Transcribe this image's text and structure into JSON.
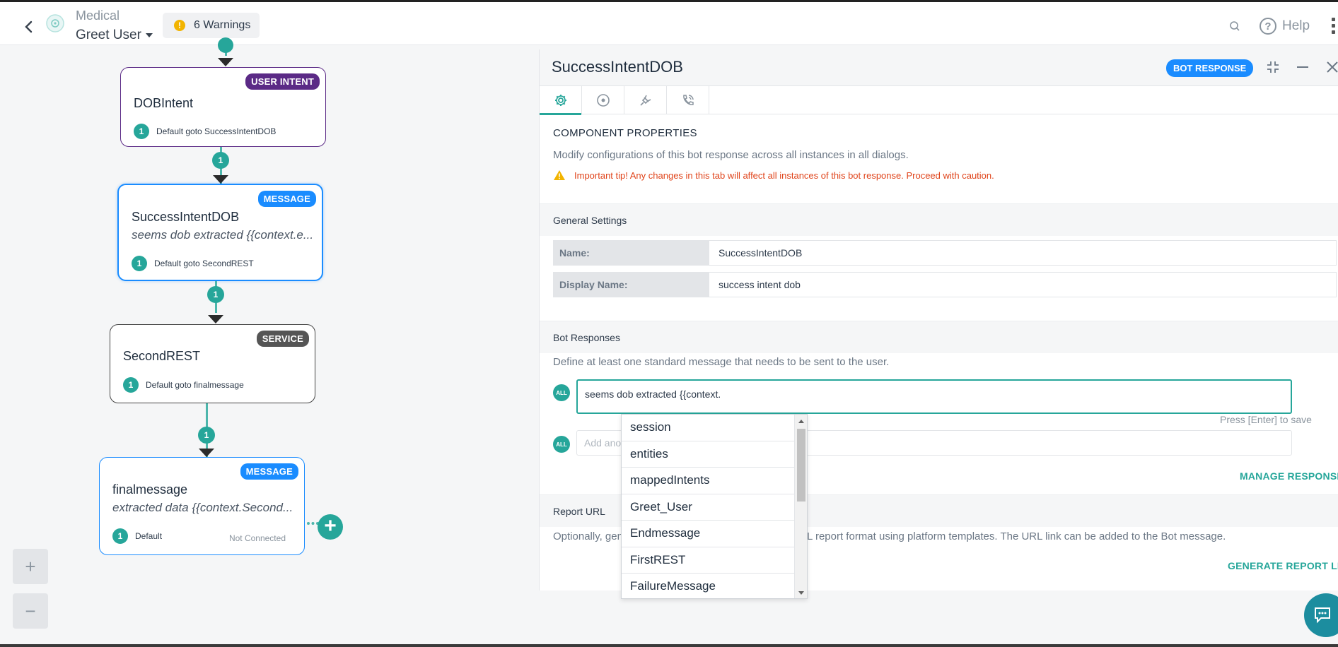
{
  "header": {
    "bot_name": "Medical",
    "dialog_name": "Greet User",
    "warnings_count": "!",
    "warnings_label": "6 Warnings",
    "help_label": "Help"
  },
  "canvas": {
    "nodes": [
      {
        "title": "DOBIntent",
        "tag": "USER INTENT",
        "transition_count": "1",
        "transition": "Default goto SuccessIntentDOB"
      },
      {
        "title": "SuccessIntentDOB",
        "subtitle": "seems dob extracted {{context.e...",
        "tag": "MESSAGE",
        "transition_count": "1",
        "transition": "Default goto SecondREST"
      },
      {
        "title": "SecondREST",
        "tag": "SERVICE",
        "transition_count": "1",
        "transition": "Default goto finalmessage"
      },
      {
        "title": "finalmessage",
        "subtitle": "extracted data {{context.Second...",
        "tag": "MESSAGE",
        "transition_count": "1",
        "transition": "Default",
        "status": "Not Connected"
      }
    ],
    "edge_labels": [
      "1",
      "1",
      "1"
    ],
    "add_node_label": "+",
    "zoom_in_label": "+",
    "zoom_out_label": "−"
  },
  "panel": {
    "title": "SuccessIntentDOB",
    "tag": "BOT RESPONSE",
    "tabs": [
      "settings-icon",
      "target-icon",
      "plug-icon",
      "phone-icon"
    ],
    "component_heading": "COMPONENT PROPERTIES",
    "component_desc": "Modify configurations of this bot response across all instances in all dialogs.",
    "tip": "Important tip! Any changes in this tab will affect all instances of this bot response. Proceed with caution.",
    "general_settings": {
      "heading": "General Settings",
      "name_label": "Name:",
      "name_value": "SuccessIntentDOB",
      "display_name_label": "Display Name:",
      "display_name_value": "success intent dob"
    },
    "bot_responses": {
      "heading": "Bot Responses",
      "desc": "Define at least one standard message that needs to be sent to the user.",
      "channel_badge": "ALL",
      "message_value": "seems dob extracted {{context.",
      "press_enter": "Press [Enter] to save",
      "add_placeholder": "Add anot",
      "manage_label": "MANAGE RESPONSES"
    },
    "report_url": {
      "heading": "Report URL",
      "desc_left": "Optionally, gen",
      "desc_right": "L report format using platform templates. The URL link can be added to the Bot message.",
      "generate_label": "GENERATE REPORT LINK"
    }
  },
  "autocomplete": {
    "items": [
      "session",
      "entities",
      "mappedIntents",
      "Greet_User",
      "Endmessage",
      "FirstREST",
      "FailureMessage"
    ]
  },
  "colors": {
    "teal": "#26a69a",
    "user_intent": "#5b2a86",
    "message": "#1a8cff",
    "service": "#555555",
    "warning": "#e0441b"
  }
}
